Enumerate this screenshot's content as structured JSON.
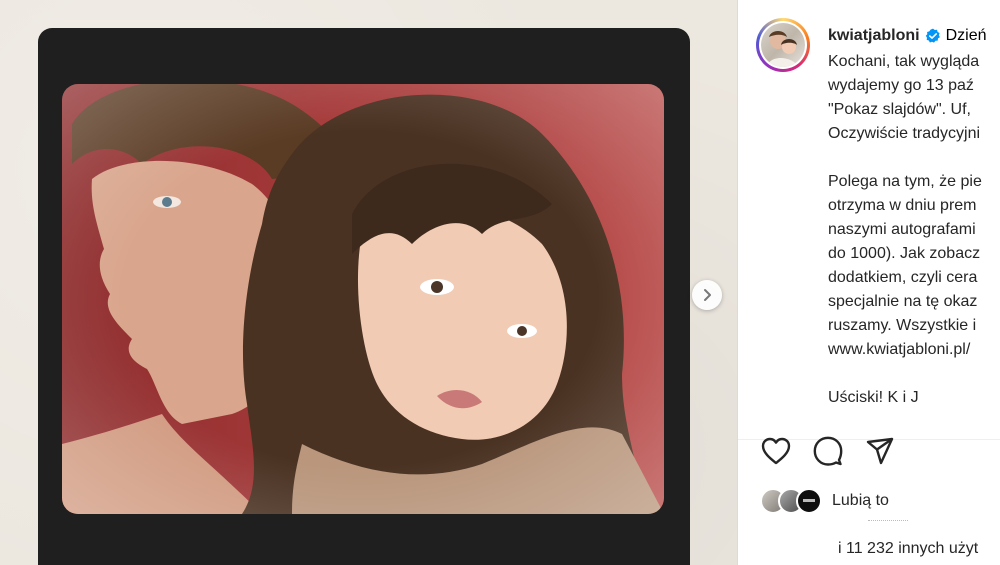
{
  "post": {
    "username": "kwiatjabloni",
    "header_text_after": "Dzień",
    "caption_lines": [
      "Kochani, tak wygląda",
      "wydajemy go 13 paź",
      "\"Pokaz slajdów\". Uf, ",
      "Oczywiście tradycyjni",
      "",
      "Polega na tym, że pie",
      "otrzyma w dniu prem",
      "naszymi autografami",
      "do 1000). Jak zobacz",
      "dodatkiem, czyli cera",
      "specjalnie na tę okaz",
      "ruszamy. Wszystkie i",
      "www.kwiatjabloni.pl/",
      "",
      "Uściski! K i J"
    ]
  },
  "likes": {
    "label": "Lubią to",
    "more": "i 11 232 innych użyt"
  },
  "icons": {
    "verified": "verified-badge-icon",
    "like": "heart-icon",
    "comment": "comment-icon",
    "share": "share-icon",
    "next": "chevron-right-icon"
  },
  "colors": {
    "photo_background": "#a63a3a",
    "frame": "#1f1f1f",
    "page_background": "#ece7df",
    "verified": "#0095f6"
  }
}
